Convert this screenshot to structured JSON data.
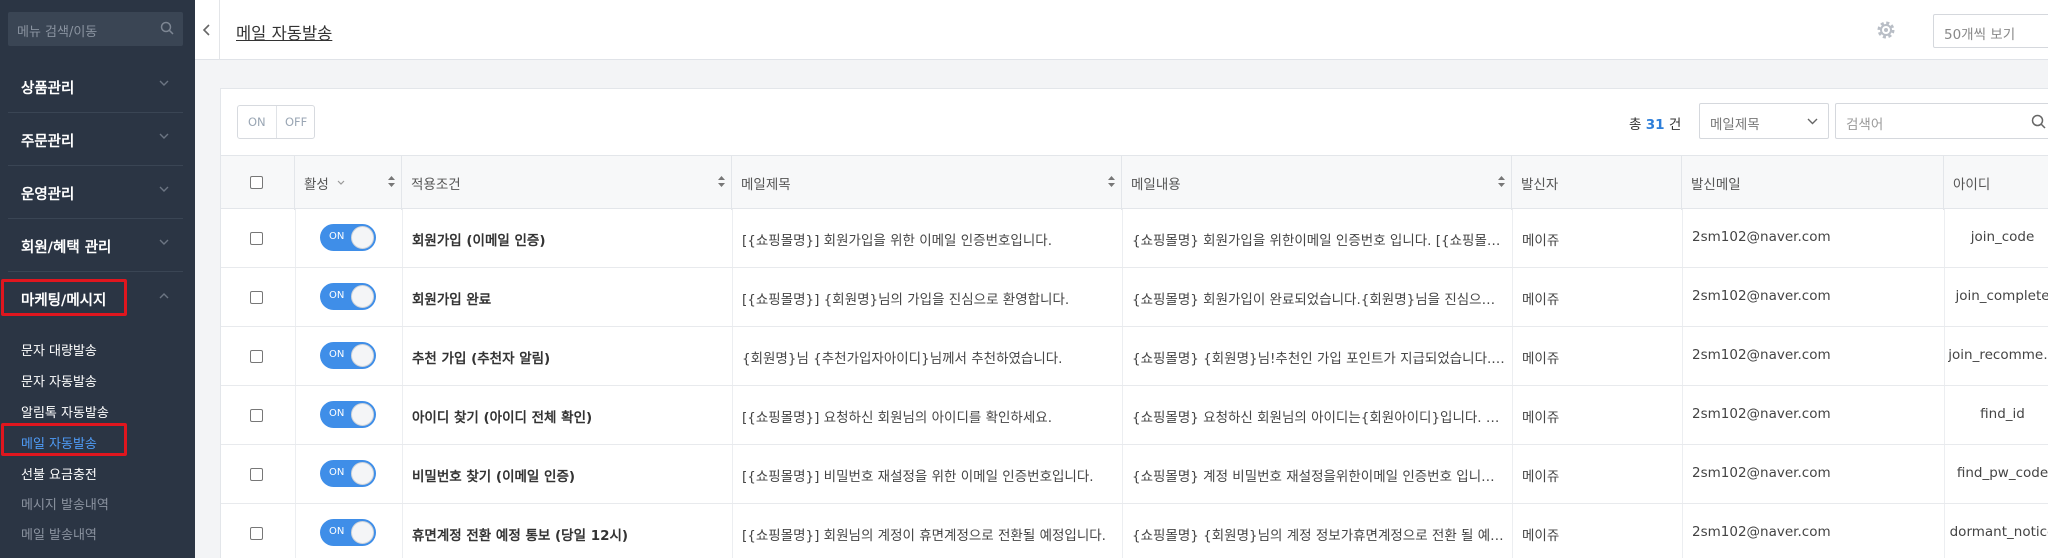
{
  "sidebar": {
    "search_placeholder": "메뉴 검색/이동",
    "menu": [
      {
        "label": "상품관리"
      },
      {
        "label": "주문관리"
      },
      {
        "label": "운영관리"
      },
      {
        "label": "회원/혜택 관리"
      },
      {
        "label": "마케팅/메시지"
      }
    ],
    "sub_items": [
      {
        "label": "문자 대량발송"
      },
      {
        "label": "문자 자동발송"
      },
      {
        "label": "알림톡 자동발송"
      },
      {
        "label": "메일 자동발송"
      },
      {
        "label": "선불 요금충전"
      },
      {
        "label": "메시지 발송내역"
      },
      {
        "label": "메일 발송내역"
      }
    ]
  },
  "header": {
    "title": "메일 자동발송",
    "per_page": "50개씩 보기"
  },
  "toolbar": {
    "on_label": "ON",
    "off_label": "OFF",
    "total_prefix": "총",
    "total_count": "31",
    "total_suffix": "건",
    "filter_select": "메일제목",
    "search_placeholder": "검색어"
  },
  "table": {
    "columns": [
      "활성",
      "적용조건",
      "메일제목",
      "메일내용",
      "발신자",
      "발신메일",
      "아이디"
    ],
    "rows": [
      {
        "toggle": "ON",
        "condition": "회원가입 (이메일 인증)",
        "subject": "[{쇼핑몰명}] 회원가입을 위한 이메일 인증번호입니다.",
        "content": "{쇼핑몰명} 회원가입을 위한이메일 인증번호 입니다. [{쇼핑몰…",
        "sender": "메이쥬",
        "email": "2sm102@naver.com",
        "id": "join_code"
      },
      {
        "toggle": "ON",
        "condition": "회원가입 완료",
        "subject": "[{쇼핑몰명}] {회원명}님의 가입을 진심으로 환영합니다.",
        "content": "{쇼핑몰명} 회원가입이 완료되었습니다.{회원명}님을 진심으…",
        "sender": "메이쥬",
        "email": "2sm102@naver.com",
        "id": "join_complete"
      },
      {
        "toggle": "ON",
        "condition": "추천 가입 (추천자 알림)",
        "subject": "{회원명}님 {추천가입자아이디}님께서 추천하였습니다.",
        "content": "{쇼핑몰명} {회원명}님!추천인 가입 포인트가 지급되었습니다.…",
        "sender": "메이쥬",
        "email": "2sm102@naver.com",
        "id": "join_recomme…"
      },
      {
        "toggle": "ON",
        "condition": "아이디 찾기 (아이디 전체 확인)",
        "subject": "[{쇼핑몰명}] 요청하신 회원님의 아이디를 확인하세요.",
        "content": "{쇼핑몰명} 요청하신 회원님의 아이디는{회원아이디}입니다. …",
        "sender": "메이쥬",
        "email": "2sm102@naver.com",
        "id": "find_id"
      },
      {
        "toggle": "ON",
        "condition": "비밀번호 찾기 (이메일 인증)",
        "subject": "[{쇼핑몰명}] 비밀번호 재설정을 위한 이메일 인증번호입니다.",
        "content": "{쇼핑몰명} 계정 비밀번호 재설정을위한이메일 인증번호 입니…",
        "sender": "메이쥬",
        "email": "2sm102@naver.com",
        "id": "find_pw_code"
      },
      {
        "toggle": "ON",
        "condition": "휴면계정 전환 예정 통보 (당일 12시)",
        "subject": "[{쇼핑몰명}] 회원님의 계정이 휴면계정으로 전환될 예정입니다.",
        "content": "{쇼핑몰명} {회원명}님의 계정 정보가휴면계정으로 전환 될 예…",
        "sender": "메이쥬",
        "email": "2sm102@naver.com",
        "id": "dormant_notice"
      }
    ]
  },
  "colors": {
    "sidebar_bg": "#2b3544",
    "accent": "#3f8ee8",
    "highlight_box": "#e0161e"
  }
}
